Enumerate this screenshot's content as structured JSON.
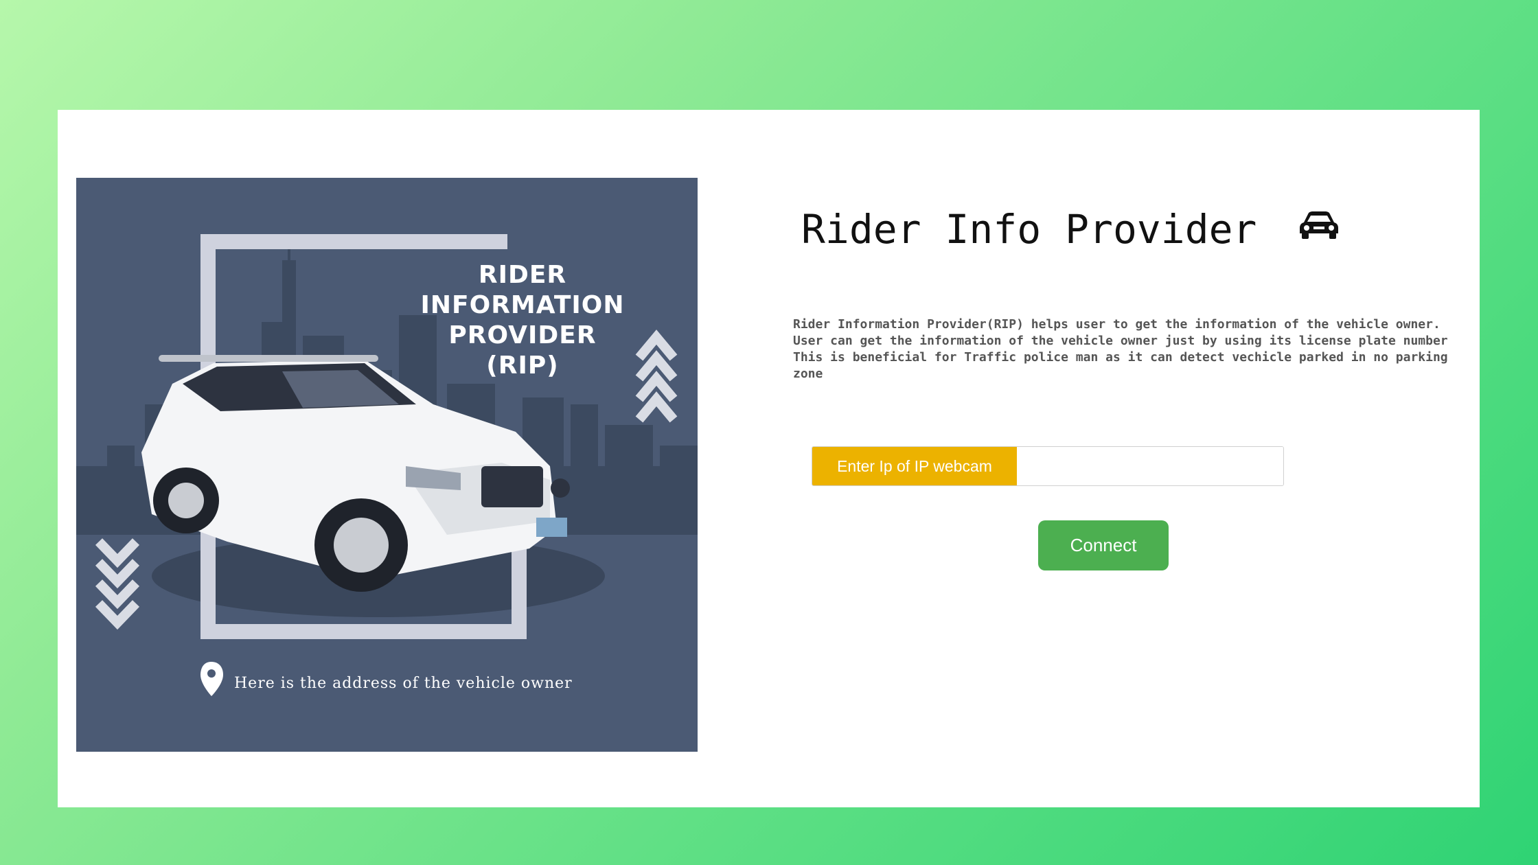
{
  "app": {
    "title": "Rider Info Provider",
    "title_icon": "car-icon"
  },
  "poster": {
    "title_lines": [
      "RIDER",
      "INFORMATION",
      "PROVIDER",
      "(RIP)"
    ],
    "address_text": "Here is the address of the vehicle owner",
    "icons": [
      "location-pin-icon",
      "chevron-up-icon",
      "chevron-down-icon"
    ]
  },
  "description": {
    "line1": "Rider Information Provider(RIP) helps user to get the information of the vehicle owner. User can get the information of the vehicle owner just by using its license plate number",
    "line2": "This is beneficial for Traffic police man as it can detect vechicle parked in no parking zone"
  },
  "ip_form": {
    "label": "Enter Ip of IP webcam",
    "value": "",
    "placeholder": ""
  },
  "connect_button": {
    "label": "Connect"
  },
  "colors": {
    "background_gradient": [
      "#b6f7ab",
      "#2fd374"
    ],
    "poster_bg": "#4b5a74",
    "label_bg": "#ecb200",
    "button_bg": "#4caf50"
  }
}
